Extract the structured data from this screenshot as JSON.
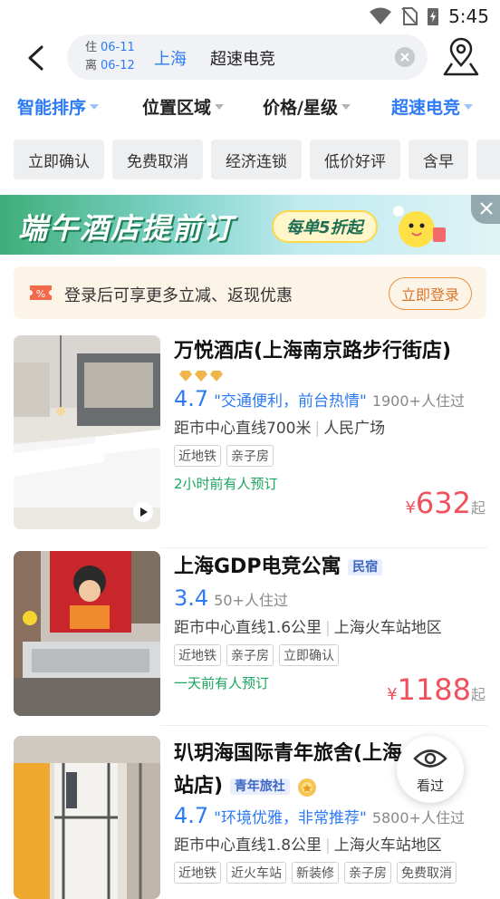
{
  "status_bar": {
    "time": "5:45"
  },
  "search": {
    "checkin_label": "住",
    "checkin_date": "06-11",
    "checkout_label": "离",
    "checkout_date": "06-12",
    "city": "上海",
    "keyword": "超速电竞"
  },
  "filters": [
    {
      "label": "智能排序"
    },
    {
      "label": "位置区域"
    },
    {
      "label": "价格/星级"
    },
    {
      "label": "超速电竞"
    }
  ],
  "quick_chips": [
    "立即确认",
    "免费取消",
    "经济连锁",
    "低价好评",
    "含早"
  ],
  "banner": {
    "title": "端午酒店提前订",
    "pill": "每单5折起"
  },
  "login_tip": {
    "text": "登录后可享更多立减、返现优惠",
    "button": "立即登录"
  },
  "hotels": [
    {
      "name": "万悦酒店(上海南京路步行街店)",
      "score": "4.7",
      "quote": "\"交通便利，前台热情\"",
      "count": "1900+人住过",
      "distance": "距市中心直线700米",
      "area": "人民广场",
      "tags": [
        "近地铁",
        "亲子房"
      ],
      "booked": "2小时前有人预订",
      "currency": "¥",
      "price": "632",
      "price_suffix": "起"
    },
    {
      "name": "上海GDP电竞公寓",
      "badge": "民宿",
      "score": "3.4",
      "count": "50+人住过",
      "distance": "距市中心直线1.6公里",
      "area": "上海火车站地区",
      "tags": [
        "近地铁",
        "亲子房",
        "立即确认"
      ],
      "booked": "一天前有人预订",
      "currency": "¥",
      "price": "1188",
      "price_suffix": "起"
    },
    {
      "name_line1": "玐玥海国际青年旅舍(上海火车",
      "name_line2": "站店)",
      "badge": "青年旅社",
      "score": "4.7",
      "quote": "\"环境优雅，非常推荐\"",
      "count": "5800+人住过",
      "distance": "距市中心直线1.8公里",
      "area": "上海火车站地区",
      "tags": [
        "近地铁",
        "近火车站",
        "新装修",
        "亲子房",
        "免费取消"
      ]
    }
  ],
  "floating": {
    "viewed": "看过"
  },
  "colors": {
    "accent": "#2d7bf4",
    "price": "#f0515d",
    "booked": "#1aa55f",
    "login": "#d9752b"
  }
}
